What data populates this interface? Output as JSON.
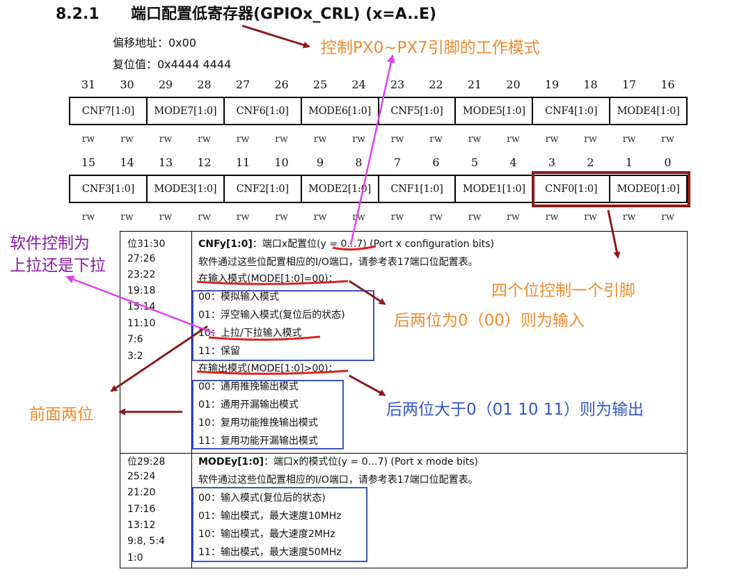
{
  "header": {
    "section_number": "8.2.1",
    "section_title": "端口配置低寄存器(GPIOx_CRL) (x=A..E)",
    "offset_label": "偏移地址：0x00",
    "reset_label": "复位值：0x4444 4444"
  },
  "register": {
    "upper_bits": [
      "31",
      "30",
      "29",
      "28",
      "27",
      "26",
      "25",
      "24",
      "23",
      "22",
      "21",
      "20",
      "19",
      "18",
      "17",
      "16"
    ],
    "upper_fields": [
      "CNF7[1:0]",
      "MODE7[1:0]",
      "CNF6[1:0]",
      "MODE6[1:0]",
      "CNF5[1:0]",
      "MODE5[1:0]",
      "CNF4[1:0]",
      "MODE4[1:0]"
    ],
    "lower_bits": [
      "15",
      "14",
      "13",
      "12",
      "11",
      "10",
      "9",
      "8",
      "7",
      "6",
      "5",
      "4",
      "3",
      "2",
      "1",
      "0"
    ],
    "lower_fields": [
      "CNF3[1:0]",
      "MODE3[1:0]",
      "CNF2[1:0]",
      "MODE2[1:0]",
      "CNF1[1:0]",
      "MODE1[1:0]",
      "CNF0[1:0]",
      "MODE0[1:0]"
    ],
    "access": "rw"
  },
  "cnf_section": {
    "bit_ranges": [
      "位31:30",
      "27:26",
      "23:22",
      "19:18",
      "15:14",
      "11:10",
      "7:6",
      "3:2"
    ],
    "heading_bold": "CNFy[1:0]",
    "heading_rest": "：端口x配置位(y = 0…7) (Port x configuration bits)",
    "desc": "软件通过这些位配置相应的I/O端口，请参考表17端口位配置表。",
    "input_mode_title": "在输入模式(MODE[1:0]=00)：",
    "input_options": [
      "00：模拟输入模式",
      "01：浮空输入模式(复位后的状态)",
      "10：上拉/下拉输入模式",
      "11：保留"
    ],
    "output_mode_title": "在输出模式(MODE[1:0]>00)：",
    "output_options": [
      "00：通用推挽输出模式",
      "01：通用开漏输出模式",
      "10：复用功能推挽输出模式",
      "11：复用功能开漏输出模式"
    ]
  },
  "mode_section": {
    "bit_ranges": [
      "位29:28",
      "25:24",
      "21:20",
      "17:16",
      "13:12",
      "9:8, 5:4",
      "1:0"
    ],
    "heading_bold": "MODEy[1:0]",
    "heading_rest": "：端口x的模式位(y = 0…7) (Port x mode bits)",
    "desc": "软件通过这些位配置相应的I/O端口，请参考表17端口位配置表。",
    "options": [
      "00：输入模式(复位后的状态)",
      "01：输出模式，最大速度10MHz",
      "10：输出模式，最大速度2MHz",
      "11：输出模式，最大速度50MHz"
    ]
  },
  "annotations": {
    "control_px": "控制PX0~PX7引脚的工作模式",
    "software_pull_1": "软件控制为",
    "software_pull_2": "上拉还是下拉",
    "four_bits": "四个位控制一个引脚",
    "input_note": "后两位为0（00）则为输入",
    "front_two": "前面两位",
    "output_note": "后两位大于0（01 10 11）则为输出"
  },
  "colors": {
    "orange": "#f08a2e",
    "purple": "#8a1aa8",
    "blue": "#3357c8",
    "magenta_arrow": "#e040f0",
    "darkred_arrow": "#8a1b1b",
    "red_underline": "#e02020"
  }
}
